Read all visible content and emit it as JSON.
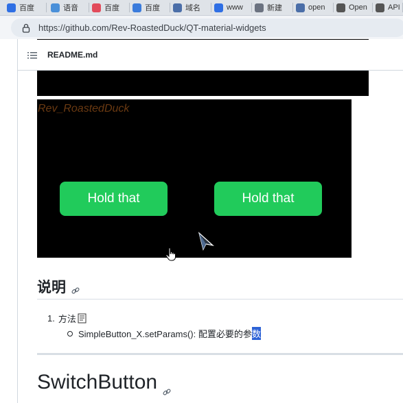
{
  "browser": {
    "tabs": [
      {
        "label": "百度",
        "icon": "baidu-icon",
        "color": "#2f6fe4"
      },
      {
        "label": "语音",
        "icon": "app-icon",
        "color": "#4a90d9"
      },
      {
        "label": "百度",
        "icon": "app-icon",
        "color": "#e24b5b"
      },
      {
        "label": "百度",
        "icon": "translate-icon",
        "color": "#3a7bdc"
      },
      {
        "label": "域名",
        "icon": "search-icon",
        "color": "#4b6ea8"
      },
      {
        "label": "www",
        "icon": "baidu-icon",
        "color": "#2f6fe4"
      },
      {
        "label": "新建",
        "icon": "page-icon",
        "color": "#6b7280"
      },
      {
        "label": "open",
        "icon": "search-icon",
        "color": "#4b6ea8"
      },
      {
        "label": "Open",
        "icon": "openai-icon",
        "color": "#555555"
      },
      {
        "label": "API",
        "icon": "openai-icon",
        "color": "#555555"
      }
    ],
    "url": "https://github.com/Rev-RoastedDuck/QT-material-widgets"
  },
  "file": {
    "name": "README.md"
  },
  "demo": {
    "watermark": "Rev_RoastedDuck",
    "buttons": [
      "Hold that",
      "Hold that"
    ],
    "button_color": "#21cb5b"
  },
  "section1": {
    "heading": "说明",
    "item1": {
      "number": "1.",
      "label": "方法"
    },
    "item2": {
      "text_before": "SimpleButton_X.setParams(): 配置必要的参",
      "selected": "数"
    }
  },
  "section2": {
    "heading": "SwitchButton"
  }
}
